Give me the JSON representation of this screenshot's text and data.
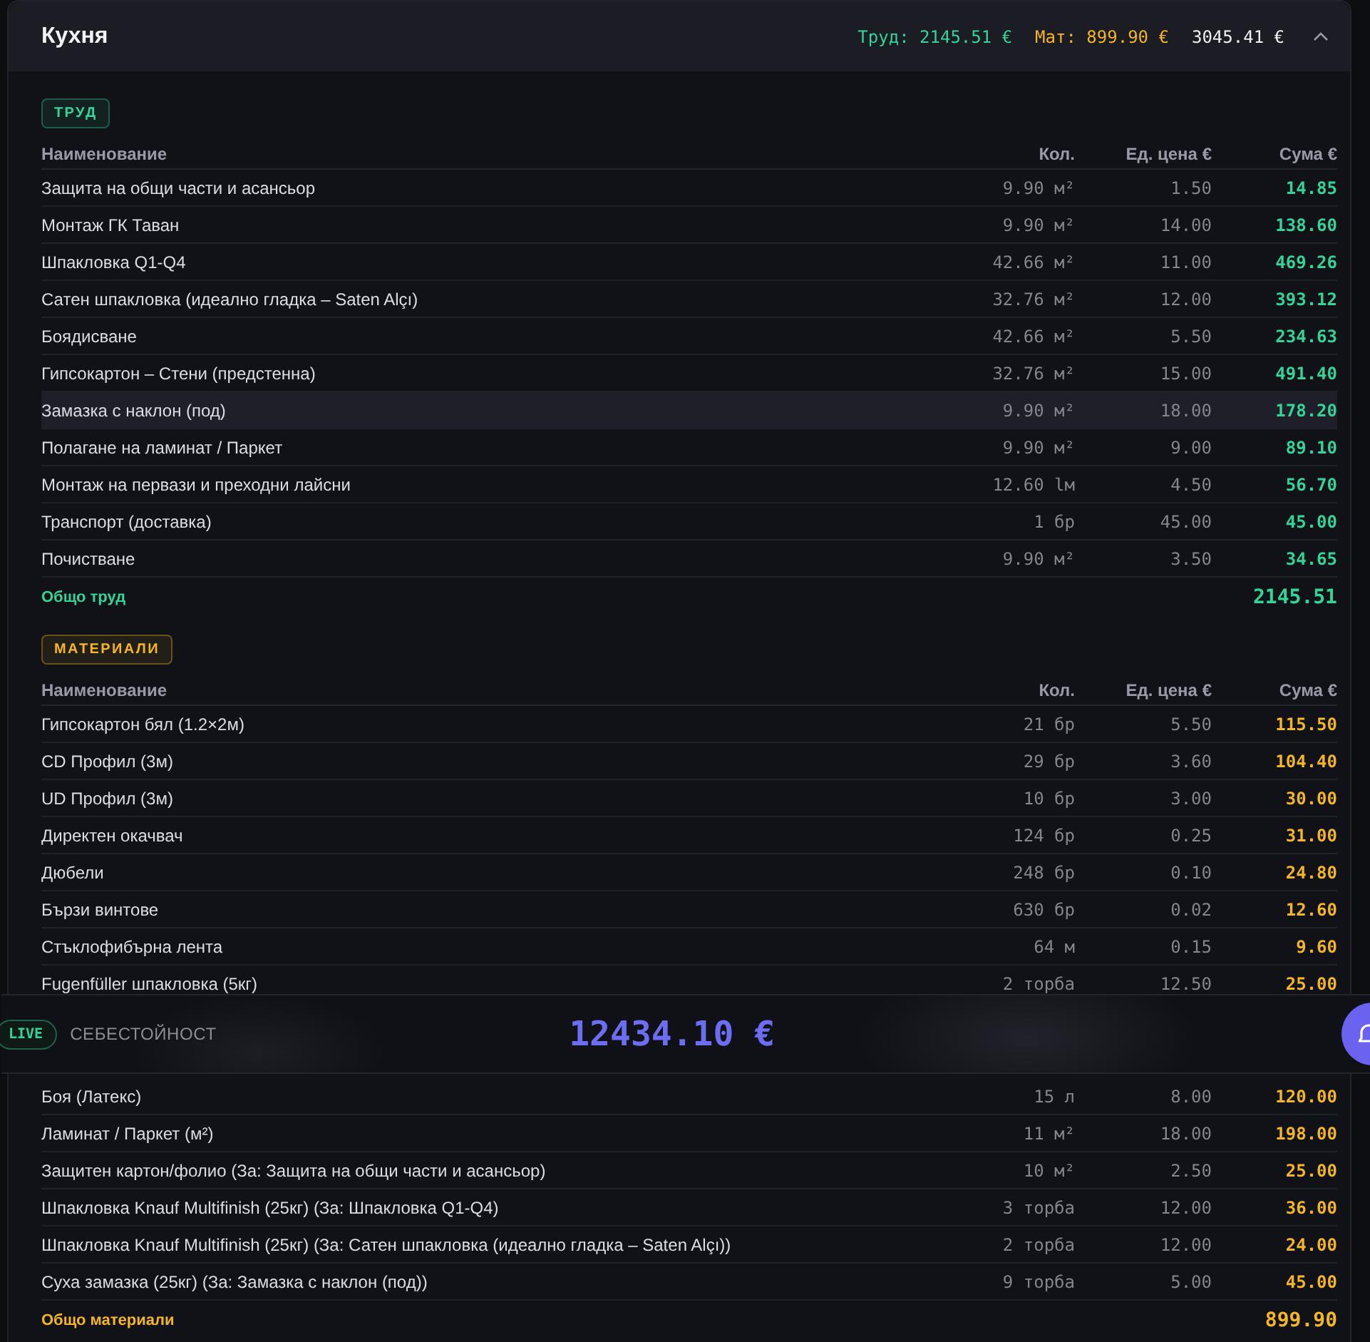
{
  "header": {
    "title": "Кухня",
    "labor_total": "Труд: 2145.51 €",
    "materials_total": "Мат: 899.90 €",
    "grand_total": "3045.41 €",
    "expanded": true
  },
  "sections": [
    {
      "kind": "labor",
      "badge": "ТРУД",
      "columns": [
        "Наименование",
        "Кол.",
        "Ед. цена €",
        "Сума €"
      ],
      "rows": [
        {
          "kind": "item",
          "name": "Защита на общи части и асансьор",
          "qty": "9.90 м²",
          "price": "1.50",
          "sum": "14.85",
          "selected": false
        },
        {
          "kind": "item",
          "name": "Монтаж ГК Таван",
          "qty": "9.90 м²",
          "price": "14.00",
          "sum": "138.60",
          "selected": false
        },
        {
          "kind": "item",
          "name": "Шпакловка Q1-Q4",
          "qty": "42.66 м²",
          "price": "11.00",
          "sum": "469.26",
          "selected": false
        },
        {
          "kind": "item",
          "name": "Сатен шпакловка (идеално гладка – Saten Alçı)",
          "qty": "32.76 м²",
          "price": "12.00",
          "sum": "393.12",
          "selected": false
        },
        {
          "kind": "item",
          "name": "Боядисване",
          "qty": "42.66 м²",
          "price": "5.50",
          "sum": "234.63",
          "selected": false
        },
        {
          "kind": "item",
          "name": "Гипсокартон – Стени (предстенна)",
          "qty": "32.76 м²",
          "price": "15.00",
          "sum": "491.40",
          "selected": false
        },
        {
          "kind": "item",
          "name": "Замазка с наклон (под)",
          "qty": "9.90 м²",
          "price": "18.00",
          "sum": "178.20",
          "selected": true
        },
        {
          "kind": "item",
          "name": "Полагане на ламинат / Паркет",
          "qty": "9.90 м²",
          "price": "9.00",
          "sum": "89.10",
          "selected": false
        },
        {
          "kind": "item",
          "name": "Монтаж на первази и преходни лайсни",
          "qty": "12.60 lм",
          "price": "4.50",
          "sum": "56.70",
          "selected": false
        },
        {
          "kind": "item",
          "name": "Транспорт (доставка)",
          "qty": "1 бр",
          "price": "45.00",
          "sum": "45.00",
          "selected": false
        },
        {
          "kind": "item",
          "name": "Почистване",
          "qty": "9.90 м²",
          "price": "3.50",
          "sum": "34.65",
          "selected": false
        }
      ],
      "total_label": "Общо труд",
      "total": "2145.51"
    },
    {
      "kind": "materials",
      "badge": "МАТЕРИАЛИ",
      "columns": [
        "Наименование",
        "Кол.",
        "Ед. цена €",
        "Сума €"
      ],
      "rows": [
        {
          "kind": "item",
          "name": "Гипсокартон бял (1.2×2м)",
          "qty": "21 бр",
          "price": "5.50",
          "sum": "115.50",
          "selected": false
        },
        {
          "kind": "item",
          "name": "CD Профил (3м)",
          "qty": "29 бр",
          "price": "3.60",
          "sum": "104.40",
          "selected": false
        },
        {
          "kind": "item",
          "name": "UD Профил (3м)",
          "qty": "10 бр",
          "price": "3.00",
          "sum": "30.00",
          "selected": false
        },
        {
          "kind": "item",
          "name": "Директен окачвач",
          "qty": "124 бр",
          "price": "0.25",
          "sum": "31.00",
          "selected": false
        },
        {
          "kind": "item",
          "name": "Дюбели",
          "qty": "248 бр",
          "price": "0.10",
          "sum": "24.80",
          "selected": false
        },
        {
          "kind": "item",
          "name": "Бързи винтове",
          "qty": "630 бр",
          "price": "0.02",
          "sum": "12.60",
          "selected": false
        },
        {
          "kind": "item",
          "name": "Стъклофибърна лента",
          "qty": "64 м",
          "price": "0.15",
          "sum": "9.60",
          "selected": false
        },
        {
          "kind": "item",
          "name": "Fugenfüller шпакловка (5кг)",
          "qty": "2 торба",
          "price": "12.50",
          "sum": "25.00",
          "selected": false
        },
        {
          "kind": "cost_bar",
          "live": "LIVE",
          "label": "СЕБЕСТОЙНОСТ",
          "value": "12434.10 €"
        },
        {
          "kind": "item",
          "name": "Боя (Латекс)",
          "qty": "15 л",
          "price": "8.00",
          "sum": "120.00",
          "selected": false
        },
        {
          "kind": "item",
          "name": "Ламинат / Паркет (м²)",
          "qty": "11 м²",
          "price": "18.00",
          "sum": "198.00",
          "selected": false
        },
        {
          "kind": "item",
          "name": "Защитен картон/фолио (За: Защита на общи части и асансьор)",
          "qty": "10 м²",
          "price": "2.50",
          "sum": "25.00",
          "selected": false
        },
        {
          "kind": "item",
          "name": "Шпакловка Knauf Multifinish (25кг) (За: Шпакловка Q1-Q4)",
          "qty": "3 торба",
          "price": "12.00",
          "sum": "36.00",
          "selected": false
        },
        {
          "kind": "item",
          "name": "Шпакловка Knauf Multifinish (25кг) (За: Сатен шпакловка (идеално гладка – Saten Alçı))",
          "qty": "2 торба",
          "price": "12.00",
          "sum": "24.00",
          "selected": false
        },
        {
          "kind": "item",
          "name": "Суха замазка (25кг) (За: Замазка с наклон (под))",
          "qty": "9 торба",
          "price": "5.00",
          "sum": "45.00",
          "selected": false
        }
      ],
      "total_label": "Общо материали",
      "total": "899.90"
    }
  ]
}
